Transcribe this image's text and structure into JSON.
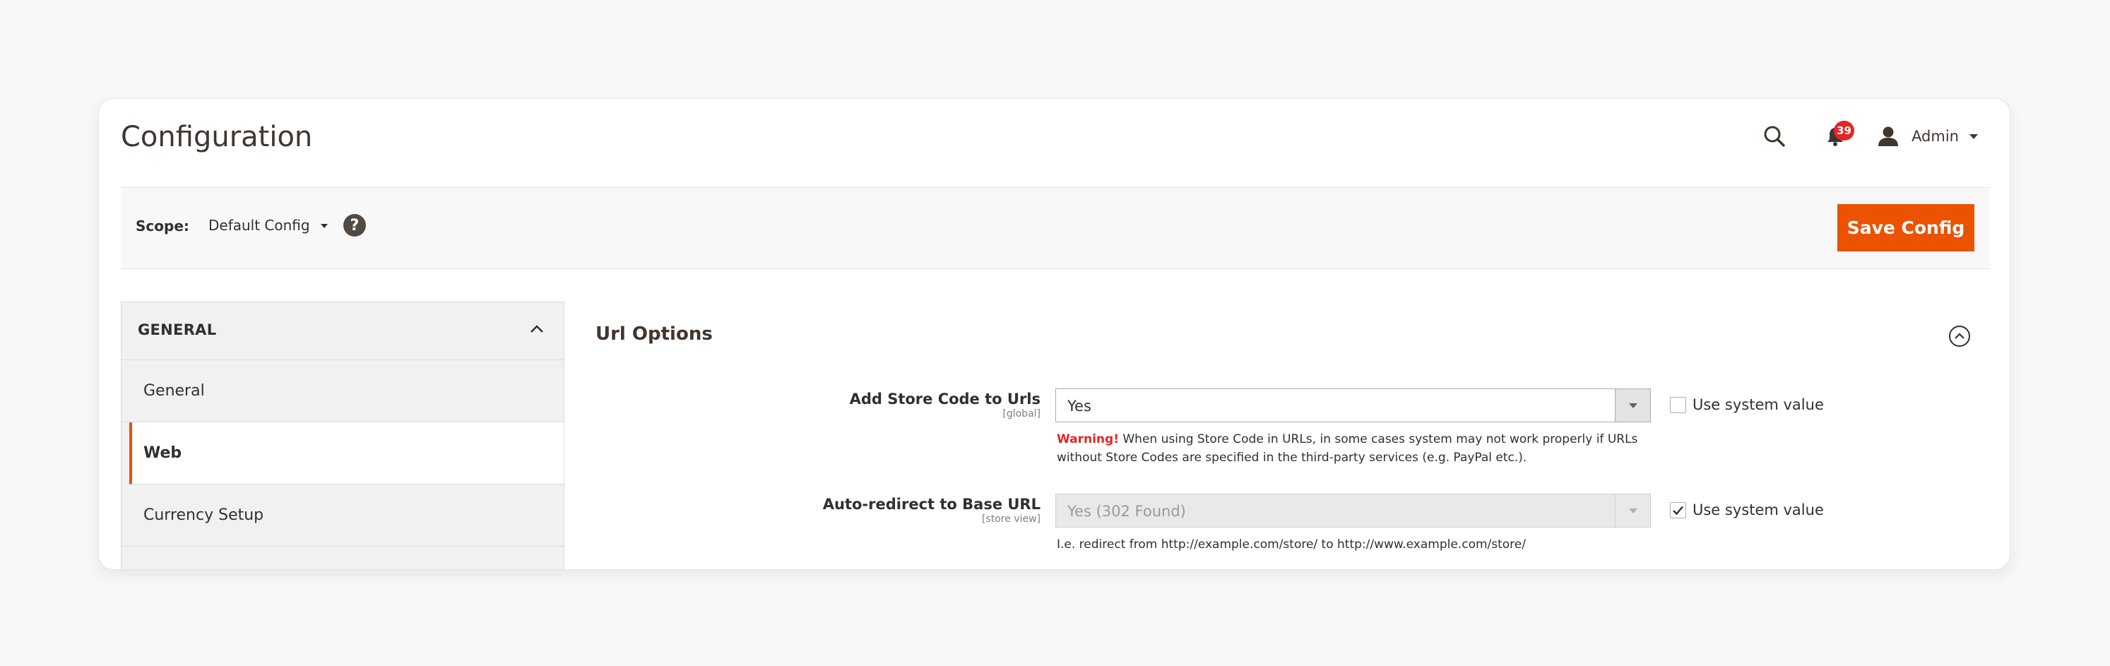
{
  "header": {
    "title": "Configuration",
    "notifications_count": "39",
    "user_label": "Admin"
  },
  "scope_bar": {
    "scope_label": "Scope:",
    "scope_value": "Default Config",
    "help_symbol": "?",
    "save_label": "Save Config"
  },
  "sidebar": {
    "section_title": "GENERAL",
    "items": [
      {
        "label": "General"
      },
      {
        "label": "Web"
      },
      {
        "label": "Currency Setup"
      }
    ]
  },
  "main": {
    "section_title": "Url Options",
    "fields": [
      {
        "label": "Add Store Code to Urls",
        "scope": "[global]",
        "value": "Yes",
        "use_system_value": "Use system value",
        "note_warning": "Warning!",
        "note_text_line1": " When using Store Code in URLs, in some cases system may not work properly if URLs",
        "note_text_line2": "without Store Codes are specified in the third-party services (e.g. PayPal etc.)."
      },
      {
        "label": "Auto-redirect to Base URL",
        "scope": "[store view]",
        "value": "Yes (302 Found)",
        "use_system_value": "Use system value",
        "note_text": "I.e. redirect from http://example.com/store/ to http://www.example.com/store/"
      }
    ]
  },
  "colors": {
    "accent": "#eb5202",
    "badge": "#e22626",
    "warning": "#e22626"
  }
}
